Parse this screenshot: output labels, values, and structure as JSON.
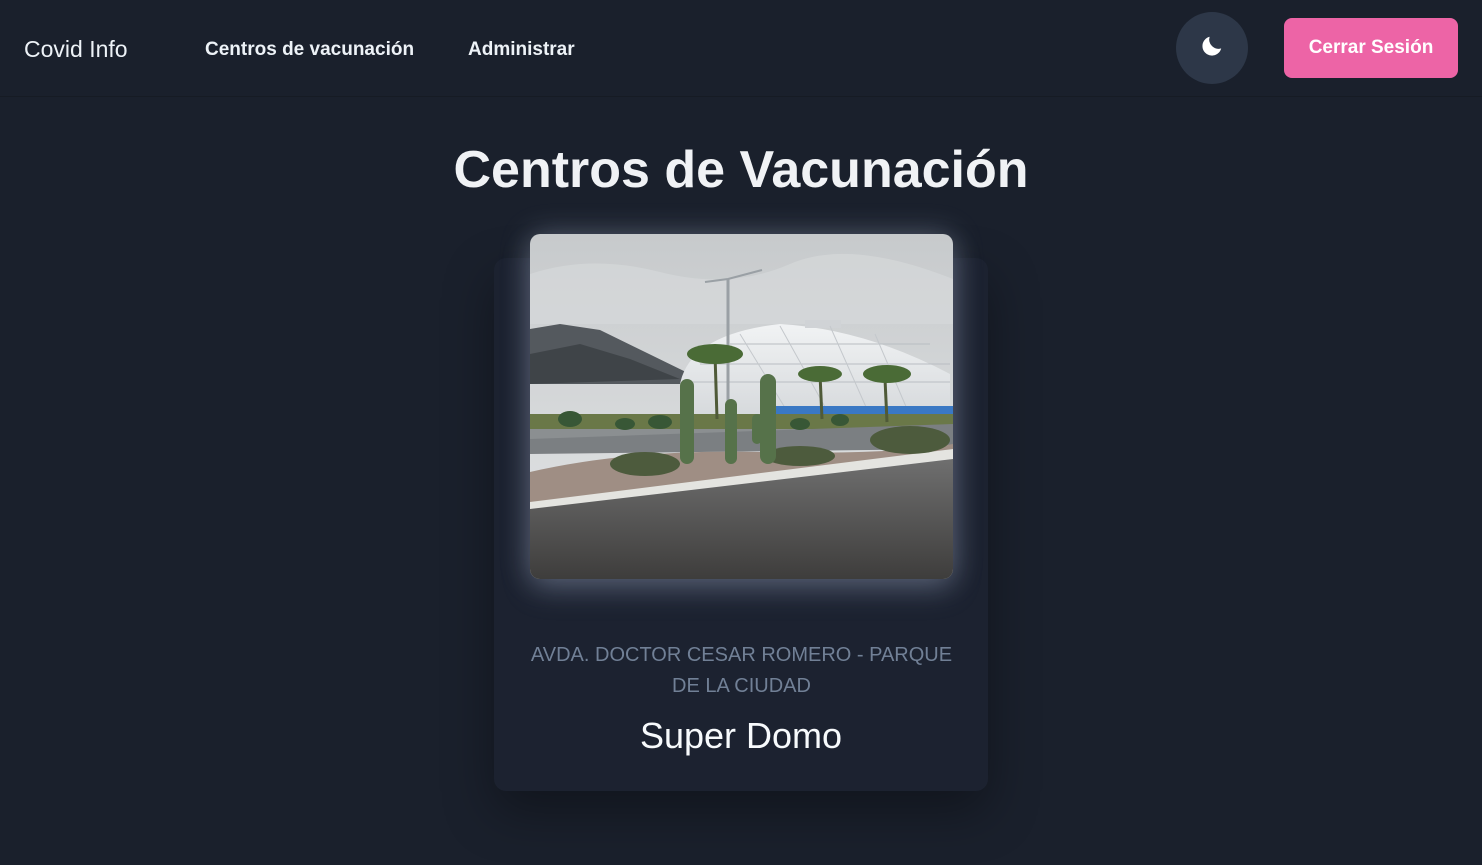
{
  "navbar": {
    "brand": "Covid Info",
    "links": [
      {
        "label": "Centros de vacunación"
      },
      {
        "label": "Administrar"
      }
    ],
    "theme_toggle_icon": "moon-icon",
    "logout_label": "Cerrar Sesión",
    "accent_color": "#ed64a6"
  },
  "main": {
    "title": "Centros de Vacunación",
    "centers": [
      {
        "address": "AVDA. DOCTOR CESAR ROMERO - PARQUE DE LA CIUDAD",
        "name": "Super Domo"
      }
    ]
  },
  "colors": {
    "background": "#1a202c",
    "toggle_background": "#2d3748",
    "muted_text": "#718096"
  }
}
